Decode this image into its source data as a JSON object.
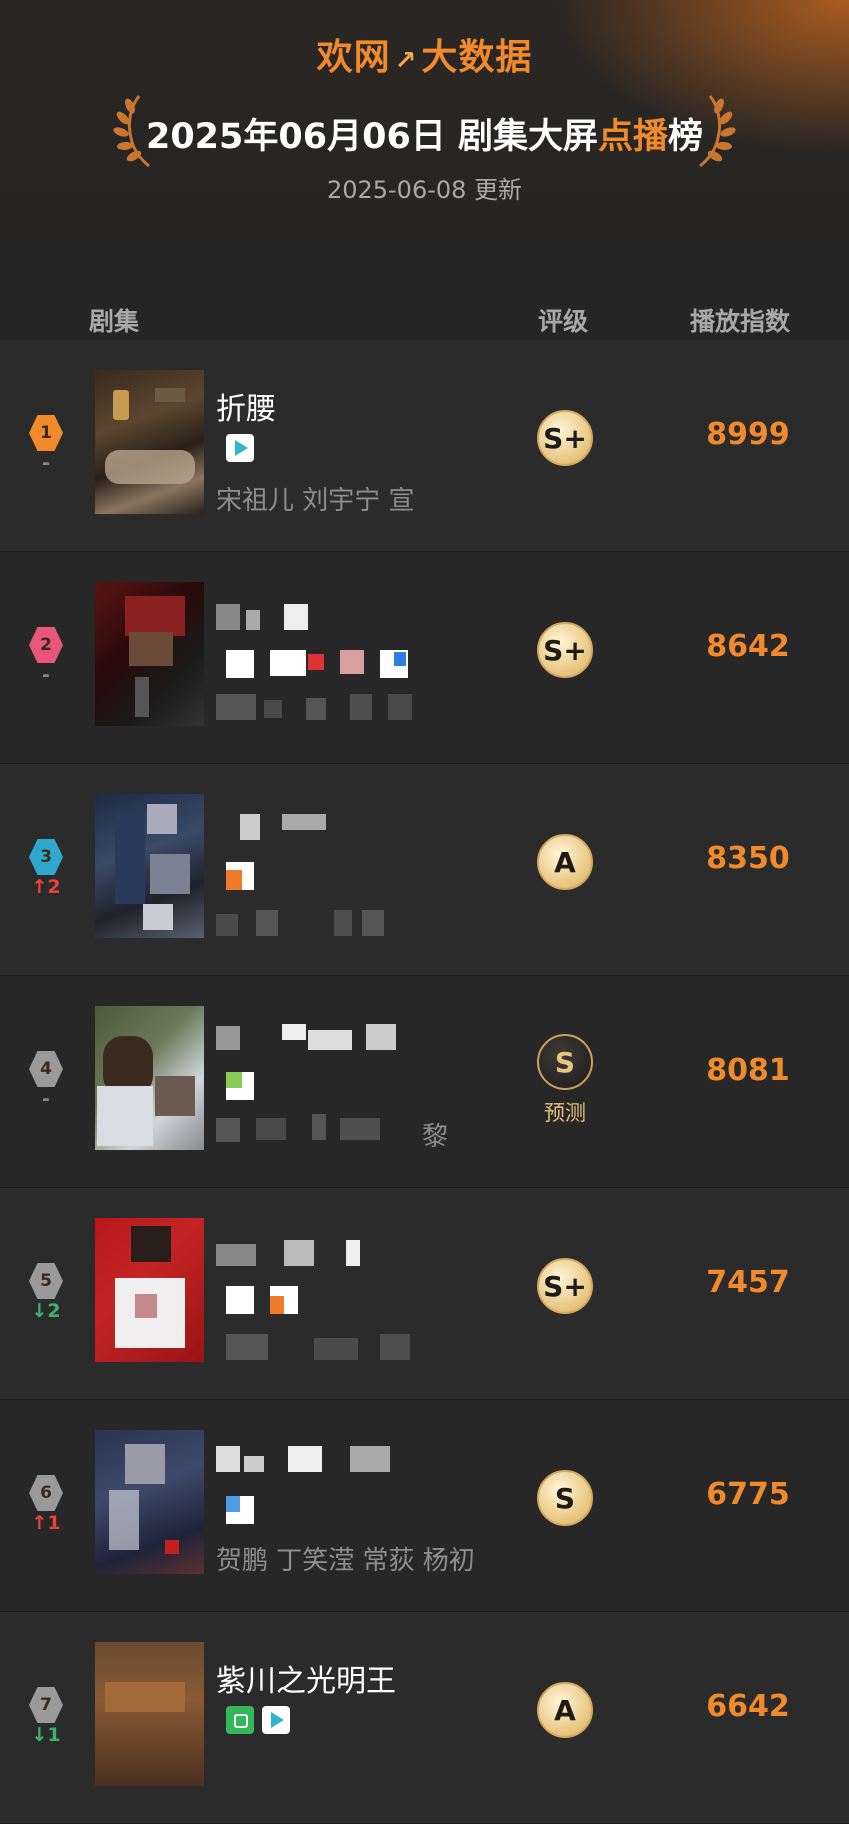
{
  "header": {
    "brand_left": "欢网",
    "brand_right": "大数据",
    "title_prefix": "2025年06月06日 剧集大屏",
    "title_highlight": "点播",
    "title_suffix": "榜",
    "updated": "2025-06-08 更新"
  },
  "columns": {
    "series": "剧集",
    "grade": "评级",
    "index": "播放指数"
  },
  "colors": {
    "accent": "#f08a2b",
    "rank_up": "#e8423a",
    "rank_down": "#3cb371"
  },
  "rows": [
    {
      "rank": "1",
      "rank_color": "#f08a2b",
      "change": "-",
      "change_dir": "none",
      "name": "折腰",
      "cast": "宋祖儿 刘宇宁 宣",
      "platforms": [
        "video-icon"
      ],
      "grade": "S+",
      "grade_prediction": "",
      "index": "8999"
    },
    {
      "rank": "2",
      "rank_color": "#e8577a",
      "change": "-",
      "change_dir": "none",
      "name": "",
      "cast": "",
      "platforms": [],
      "grade": "S+",
      "grade_prediction": "",
      "index": "8642"
    },
    {
      "rank": "3",
      "rank_color": "#2fa8d0",
      "change": "↑2",
      "change_dir": "up",
      "name": "",
      "cast": "",
      "platforms": [],
      "grade": "A",
      "grade_prediction": "",
      "index": "8350"
    },
    {
      "rank": "4",
      "rank_color": "#9a9a9a",
      "change": "-",
      "change_dir": "none",
      "name": "",
      "cast": "黎",
      "platforms": [],
      "grade": "S",
      "grade_prediction": "预测",
      "index": "8081"
    },
    {
      "rank": "5",
      "rank_color": "#9a9a9a",
      "change": "↓2",
      "change_dir": "down",
      "name": "",
      "cast": "",
      "platforms": [],
      "grade": "S+",
      "grade_prediction": "",
      "index": "7457"
    },
    {
      "rank": "6",
      "rank_color": "#9a9a9a",
      "change": "↑1",
      "change_dir": "up",
      "name": "",
      "cast": "贺鹏 丁笑滢 常荻 杨初",
      "platforms": [],
      "grade": "S",
      "grade_prediction": "",
      "index": "6775"
    },
    {
      "rank": "7",
      "rank_color": "#9a9a9a",
      "change": "↓1",
      "change_dir": "down",
      "name": "紫川之光明王",
      "cast": "",
      "platforms": [
        "tv-icon",
        "video-icon"
      ],
      "grade": "A",
      "grade_prediction": "",
      "index": "6642"
    }
  ]
}
